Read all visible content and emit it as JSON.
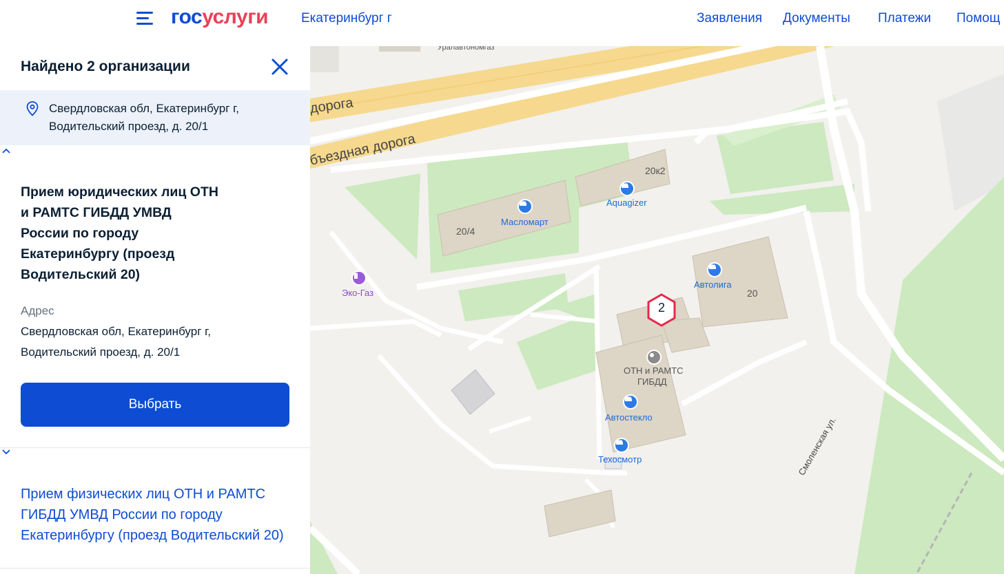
{
  "header": {
    "logo_part1": "гос",
    "logo_part2": "услуги",
    "city": "Екатеринбург г",
    "nav": [
      "Заявления",
      "Документы",
      "Платежи",
      "Помощ"
    ]
  },
  "sidebar": {
    "title": "Найдено 2 организации",
    "search_address_line1": "Свердловская обл, Екатеринбург г,",
    "search_address_line2": "Водительский проезд, д. 20/1",
    "org1": {
      "name_lines": [
        "Прием юридических лиц ОТН",
        "и РАМТС ГИБДД УМВД",
        "России по городу",
        "Екатеринбургу (проезд",
        "Водительский 20)"
      ],
      "address_label": "Адрес",
      "address_line1": "Свердловская обл, Екатеринбург г,",
      "address_line2": "Водительский проезд, д. 20/1",
      "select_button": "Выбрать"
    },
    "org2": {
      "name_lines": [
        "Прием физических лиц ОТН и РАМТС",
        "ГИБДД УМВД России по городу",
        "Екатеринбургу (проезд Водительский 20)"
      ]
    }
  },
  "map": {
    "road_top": "дорога",
    "road_bypass": "бъездная дорога",
    "street": "Смоленская ул.",
    "top_cut_label": "Уралавтономгаз",
    "buildings": [
      "20к2",
      "20/4",
      "20"
    ],
    "pois": [
      "Aquagizer",
      "Масломарт",
      "Эко-Газ",
      "Автолига",
      "ОТН и РАМТС",
      "ГИБДД",
      "Автостекло",
      "Техосмотр"
    ],
    "marker_count": "2",
    "colors": {
      "accent": "#0d4cd3",
      "brand_red": "#ee3f58",
      "poi_blue": "#2d7ae6",
      "marker_red": "#e5294b"
    }
  }
}
